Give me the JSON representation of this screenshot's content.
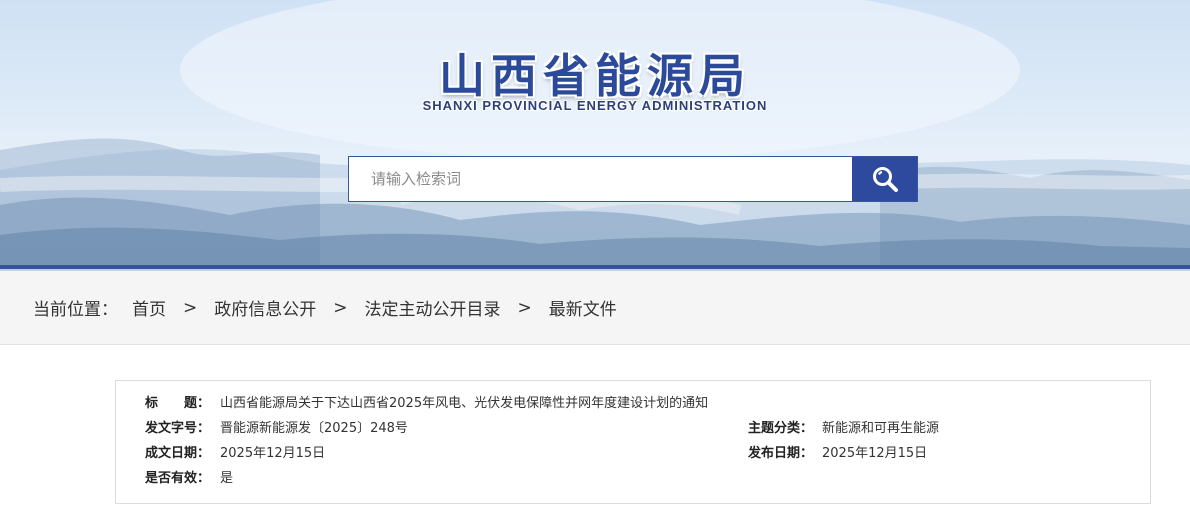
{
  "header": {
    "title": "山西省能源局",
    "subtitle": "SHANXI PROVINCIAL ENERGY ADMINISTRATION"
  },
  "search": {
    "placeholder": "请输入检索词",
    "button_icon": "search-icon"
  },
  "breadcrumb": {
    "label": "当前位置：",
    "items": [
      "首页",
      "政府信息公开",
      "法定主动公开目录",
      "最新文件"
    ],
    "separator": ">"
  },
  "meta": {
    "title_label": "标　　题：",
    "title_value": "山西省能源局关于下达山西省2025年风电、光伏发电保障性并网年度建设计划的通知",
    "doc_no_label": "发文字号：",
    "doc_no_value": "晋能源新能源发〔2025〕248号",
    "topic_label": "主题分类：",
    "topic_value": "新能源和可再生能源",
    "written_label": "成文日期：",
    "written_value": "2025年12月15日",
    "published_label": "发布日期：",
    "published_value": "2025年12月15日",
    "valid_label": "是否有效：",
    "valid_value": "是"
  },
  "colors": {
    "brand_blue": "#2d4a9e",
    "stripe_blue": "#3352a6",
    "breadcrumb_bg": "#f5f5f5"
  }
}
